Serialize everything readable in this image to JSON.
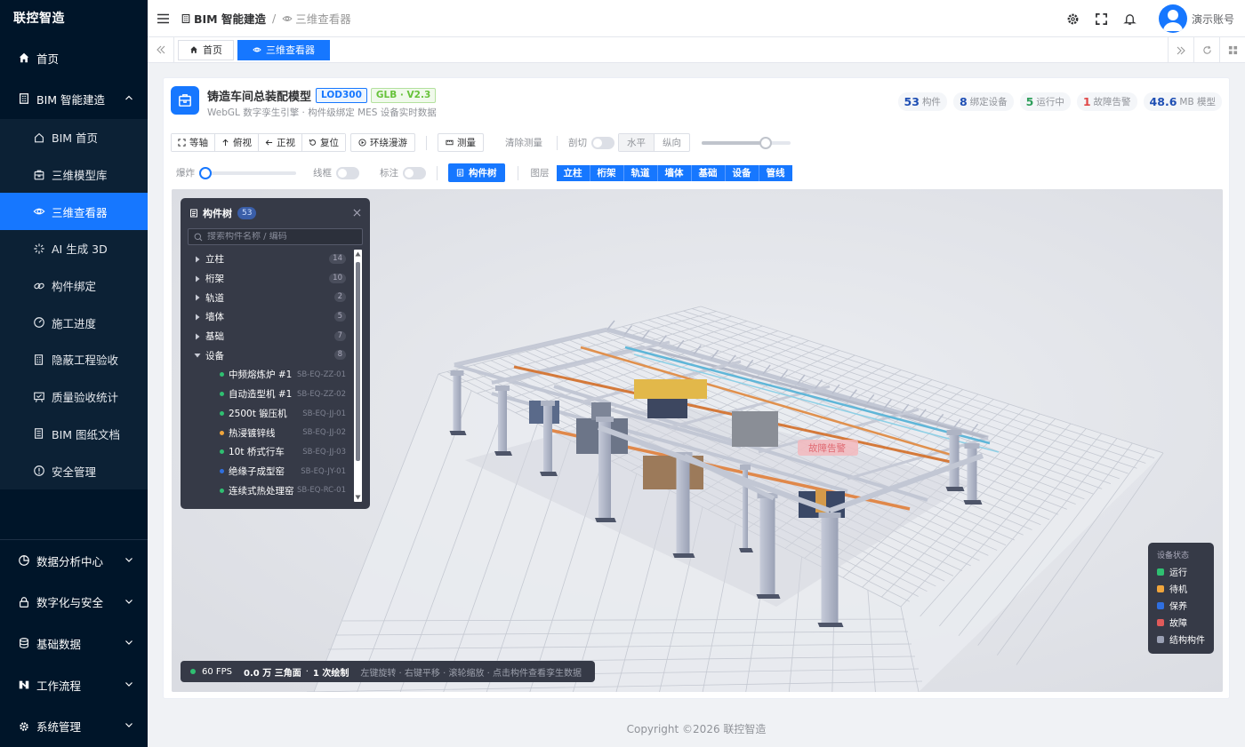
{
  "app": {
    "name": "联控智造"
  },
  "sidebar": {
    "items": [
      {
        "label": "首页",
        "icon": "home-icon"
      },
      {
        "label": "BIM 智能建造",
        "icon": "building-icon",
        "expanded": true
      }
    ],
    "bim_sub": [
      {
        "label": "BIM 首页",
        "icon": "home-outline-icon"
      },
      {
        "label": "三维模型库",
        "icon": "box-icon"
      },
      {
        "label": "三维查看器",
        "icon": "eye-icon",
        "active": true
      },
      {
        "label": "AI 生成 3D",
        "icon": "sparkle-icon"
      },
      {
        "label": "构件绑定",
        "icon": "link-icon"
      },
      {
        "label": "施工进度",
        "icon": "gauge-icon"
      },
      {
        "label": "隐蔽工程验收",
        "icon": "building-outline-icon"
      },
      {
        "label": "质量验收统计",
        "icon": "award-icon"
      },
      {
        "label": "BIM 图纸文档",
        "icon": "document-icon"
      },
      {
        "label": "安全管理",
        "icon": "alert-icon"
      }
    ],
    "bottom": [
      {
        "label": "数据分析中心",
        "icon": "pie-chart-icon"
      },
      {
        "label": "数字化与安全",
        "icon": "lock-icon"
      },
      {
        "label": "基础数据",
        "icon": "database-icon"
      },
      {
        "label": "工作流程",
        "icon": "workflow-icon"
      },
      {
        "label": "系统管理",
        "icon": "gear-icon"
      }
    ]
  },
  "header": {
    "breadcrumb": [
      "BIM 智能建造",
      "三维查看器"
    ],
    "user": "演示账号"
  },
  "tabs": [
    {
      "label": "首页",
      "active": false
    },
    {
      "label": "三维查看器",
      "active": true
    }
  ],
  "model": {
    "title": "铸造车间总装配模型",
    "lod": "LOD300",
    "format": "GLB · V2.3",
    "subtitle": "WebGL 数字孪生引擎 · 构件级绑定 MES 设备实时数据",
    "stats": [
      {
        "value": "53",
        "label": "构件",
        "color": "#1f4fb4"
      },
      {
        "value": "8",
        "label": "绑定设备",
        "color": "#1f4fb4"
      },
      {
        "value": "5",
        "label": "运行中",
        "color": "#2e9e5b"
      },
      {
        "value": "1",
        "label": "故障告警",
        "color": "#e04848"
      },
      {
        "value": "48.6",
        "label": "MB 模型",
        "color": "#1f4fb4"
      }
    ]
  },
  "toolbar": {
    "views": [
      "等轴",
      "俯视",
      "正视",
      "复位"
    ],
    "orbit": "环绕漫游",
    "measure": "测量",
    "clear_measure": "清除测量",
    "section_label": "剖切",
    "section_modes": [
      "水平",
      "纵向"
    ],
    "section_level": 0.72,
    "explode_label": "爆炸",
    "explode_level": 0.0,
    "wireframe_label": "线框",
    "annotate_label": "标注",
    "tree_button": "构件树",
    "layers_label": "图层",
    "layers": [
      "立柱",
      "桁架",
      "轨道",
      "墙体",
      "基础",
      "设备",
      "管线"
    ]
  },
  "tree": {
    "title": "构件树",
    "count": "53",
    "search_placeholder": "搜索构件名称 / 编码",
    "groups": [
      {
        "label": "立柱",
        "count": "14"
      },
      {
        "label": "桁架",
        "count": "10"
      },
      {
        "label": "轨道",
        "count": "2"
      },
      {
        "label": "墙体",
        "count": "5"
      },
      {
        "label": "基础",
        "count": "7"
      },
      {
        "label": "设备",
        "count": "8"
      }
    ],
    "devices": [
      {
        "name": "中频熔炼炉 #1",
        "code": "SB-EQ-ZZ-01",
        "status": "#2fbf71"
      },
      {
        "name": "自动造型机 #1",
        "code": "SB-EQ-ZZ-02",
        "status": "#2fbf71"
      },
      {
        "name": "2500t 锻压机",
        "code": "SB-EQ-JJ-01",
        "status": "#2fbf71"
      },
      {
        "name": "热浸镀锌线",
        "code": "SB-EQ-JJ-02",
        "status": "#f0a53c"
      },
      {
        "name": "10t 桥式行车",
        "code": "SB-EQ-JJ-03",
        "status": "#2fbf71"
      },
      {
        "name": "绝缘子成型窑",
        "code": "SB-EQ-JY-01",
        "status": "#2f6fe0"
      },
      {
        "name": "连续式热处理窑",
        "code": "SB-EQ-RC-01",
        "status": "#2fbf71"
      }
    ]
  },
  "scene": {
    "fault_tag": "故障告警"
  },
  "legend": {
    "title": "设备状态",
    "items": [
      {
        "label": "运行",
        "color": "#2fbf71"
      },
      {
        "label": "待机",
        "color": "#f0a53c"
      },
      {
        "label": "保养",
        "color": "#2f6fe0"
      },
      {
        "label": "故障",
        "color": "#e05a5a"
      },
      {
        "label": "结构构件",
        "color": "#9aa0b4"
      }
    ]
  },
  "status_bar": {
    "fps": "60 FPS",
    "triangles": "0.0 万 三角面",
    "draws": "1 次绘制",
    "hint": "左键旋转 · 右键平移 · 滚轮缩放 · 点击构件查看孪生数据"
  },
  "footer": {
    "copyright": "Copyright ©2026 联控智造"
  }
}
